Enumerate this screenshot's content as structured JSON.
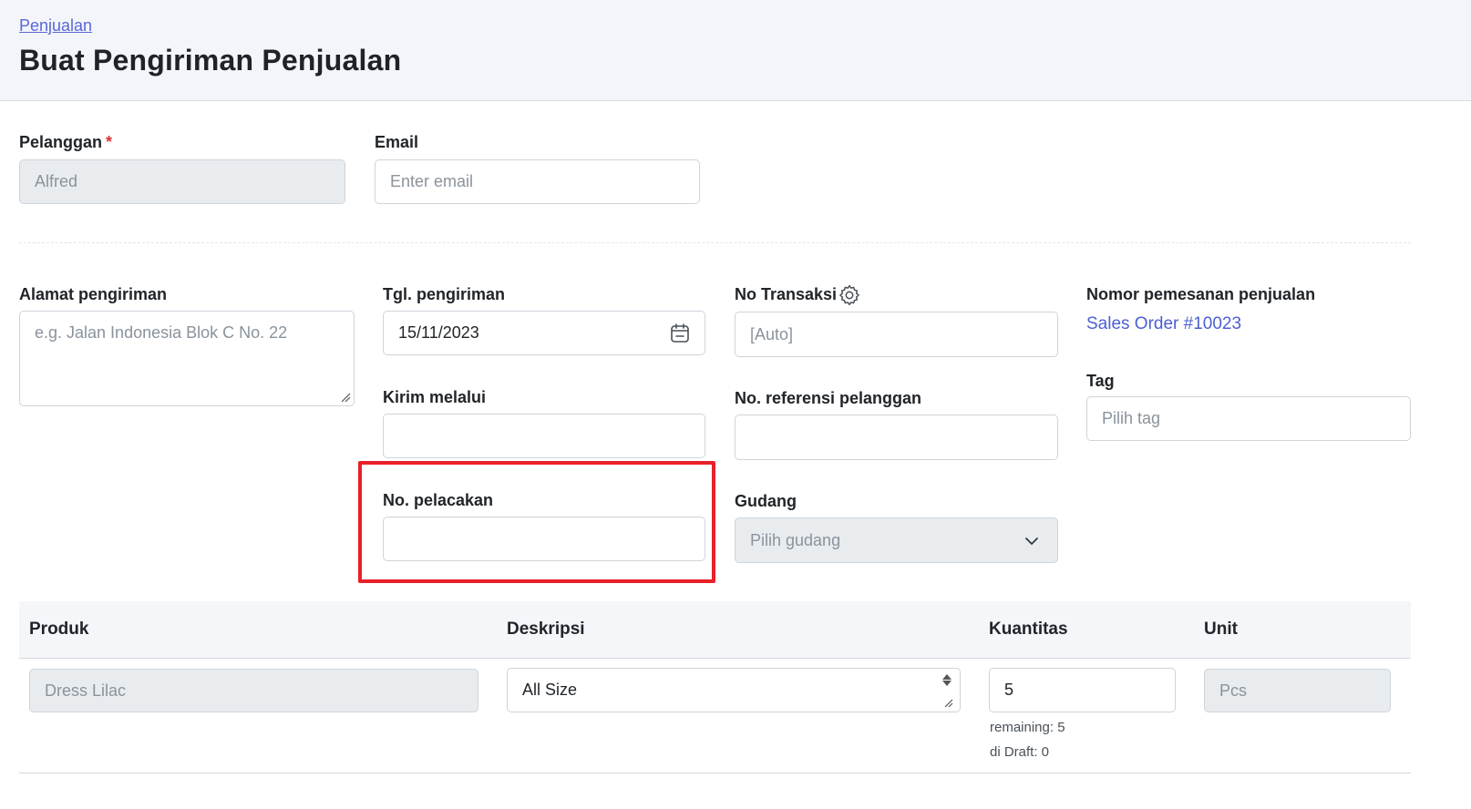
{
  "header": {
    "breadcrumb": "Penjualan",
    "title": "Buat Pengiriman Penjualan"
  },
  "customer": {
    "label": "Pelanggan",
    "required_mark": "*",
    "value": "Alfred"
  },
  "email": {
    "label": "Email",
    "placeholder": "Enter email"
  },
  "shipping_address": {
    "label": "Alamat pengiriman",
    "placeholder": "e.g. Jalan Indonesia Blok C No. 22"
  },
  "shipping_date": {
    "label": "Tgl. pengiriman",
    "value": "15/11/2023"
  },
  "transaction_no": {
    "label": "No Transaksi",
    "placeholder": "[Auto]"
  },
  "sales_order": {
    "label": "Nomor pemesanan penjualan",
    "value": "Sales Order #10023"
  },
  "ship_via": {
    "label": "Kirim melalui",
    "value": ""
  },
  "customer_reference": {
    "label": "No. referensi pelanggan",
    "value": ""
  },
  "tag": {
    "label": "Tag",
    "placeholder": "Pilih tag"
  },
  "tracking_no": {
    "label": "No. pelacakan",
    "value": "",
    "highlight_color": "#e8202a"
  },
  "warehouse": {
    "label": "Gudang",
    "placeholder": "Pilih gudang"
  },
  "table": {
    "headers": [
      "Produk",
      "Deskripsi",
      "Kuantitas",
      "Unit"
    ],
    "rows": [
      {
        "product": "Dress Lilac",
        "description": "All Size",
        "quantity": "5",
        "remaining": "remaining: 5",
        "draft": "di Draft: 0",
        "unit": "Pcs"
      }
    ]
  },
  "colors": {
    "accent": "#4c5fd5",
    "header_bg": "#f3f5fa",
    "required": "#e03131"
  },
  "icons": {
    "date_picker": "calendar-icon",
    "settings": "gear-icon",
    "dropdown": "chevron-down-icon"
  }
}
